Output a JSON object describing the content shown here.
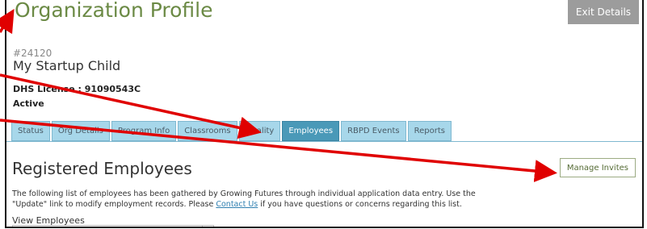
{
  "header": {
    "title": "Organization Profile",
    "exit_label": "Exit Details"
  },
  "org": {
    "id": "#24120",
    "name": "My Startup Child",
    "license": "DHS License : 91090543C",
    "status": "Active"
  },
  "tabs": [
    {
      "label": "Status",
      "active": false
    },
    {
      "label": "Org Details",
      "active": false
    },
    {
      "label": "Program Info",
      "active": false
    },
    {
      "label": "Classrooms",
      "active": false
    },
    {
      "label": "Quality",
      "active": false
    },
    {
      "label": "Employees",
      "active": true
    },
    {
      "label": "RBPD Events",
      "active": false
    },
    {
      "label": "Reports",
      "active": false
    }
  ],
  "section": {
    "title": "Registered Employees",
    "manage_label": "Manage Invites",
    "desc_1": "The following list of employees has been gathered by Growing Futures through individual application data entry. Use the",
    "desc_2": "\"Update\" link to modify employment records. Please ",
    "contact_link": "Contact Us",
    "desc_3": " if you have questions or concerns regarding this list.",
    "view_label": "View Employees"
  },
  "colors": {
    "title_green": "#6b8a45",
    "tab_bg": "#a7d7ea",
    "tab_active": "#4a99b8",
    "annotation_red": "#e00000"
  }
}
